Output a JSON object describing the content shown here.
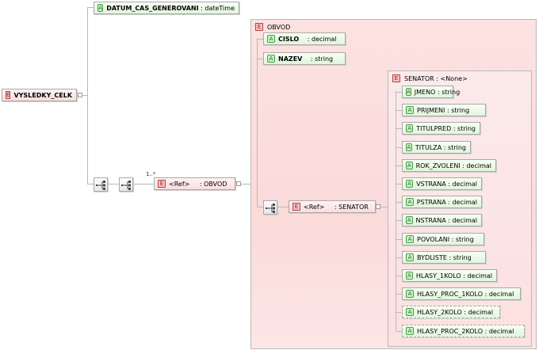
{
  "root": {
    "badge": "E",
    "name": "VYSLEDKY_CELK"
  },
  "datum": {
    "badge": "A",
    "name": "DATUM_CAS_GENEROVANI",
    "sep": " : ",
    "type": "dateTime"
  },
  "obvod_ref": {
    "badge": "E",
    "ref": "<Ref>",
    "sep": " : ",
    "name": "OBVOD",
    "cardinality": "1..*"
  },
  "obvod_container": {
    "title_badge": "E",
    "title": "OBVOD",
    "attributes": [
      {
        "badge": "A",
        "name": "CISLO",
        "sep": " : ",
        "type": "decimal"
      },
      {
        "badge": "A",
        "name": "NAZEV",
        "sep": " : ",
        "type": "string"
      }
    ]
  },
  "senator_ref": {
    "badge": "E",
    "ref": "<Ref>",
    "sep": " : ",
    "name": "SENATOR"
  },
  "senator_container": {
    "title_badge": "E",
    "title": "SENATOR : <None>",
    "attributes": [
      {
        "badge": "A",
        "name": "JMENO",
        "sep": " : ",
        "type": "string"
      },
      {
        "badge": "A",
        "name": "PRIJMENI",
        "sep": " : ",
        "type": "string"
      },
      {
        "badge": "A",
        "name": "TITULPRED",
        "sep": " : ",
        "type": "string"
      },
      {
        "badge": "A",
        "name": "TITULZA",
        "sep": " : ",
        "type": "string"
      },
      {
        "badge": "A",
        "name": "ROK_ZVOLENI",
        "sep": " : ",
        "type": "decimal"
      },
      {
        "badge": "A",
        "name": "VSTRANA",
        "sep": " : ",
        "type": "decimal"
      },
      {
        "badge": "A",
        "name": "PSTRANA",
        "sep": " : ",
        "type": "decimal"
      },
      {
        "badge": "A",
        "name": "NSTRANA",
        "sep": " : ",
        "type": "decimal"
      },
      {
        "badge": "A",
        "name": "POVOLANI",
        "sep": " : ",
        "type": "string"
      },
      {
        "badge": "A",
        "name": "BYDLISTE",
        "sep": " : ",
        "type": "string"
      },
      {
        "badge": "A",
        "name": "HLASY_1KOLO",
        "sep": " : ",
        "type": "decimal"
      },
      {
        "badge": "A",
        "name": "HLASY_PROC_1KOLO",
        "sep": " : ",
        "type": "decimal"
      },
      {
        "badge": "A",
        "name": "HLASY_2KOLO",
        "sep": " : ",
        "type": "decimal"
      },
      {
        "badge": "A",
        "name": "HLASY_PROC_2KOLO",
        "sep": " : ",
        "type": "decimal"
      }
    ]
  },
  "colors": {
    "element_fill": "#fbdcdc",
    "attribute_fill": "#e2f5dc",
    "container_fill": "#fde0e0",
    "line": "#b9b9b9"
  },
  "icons": {
    "sequence": "sequence-compositor-icon"
  }
}
